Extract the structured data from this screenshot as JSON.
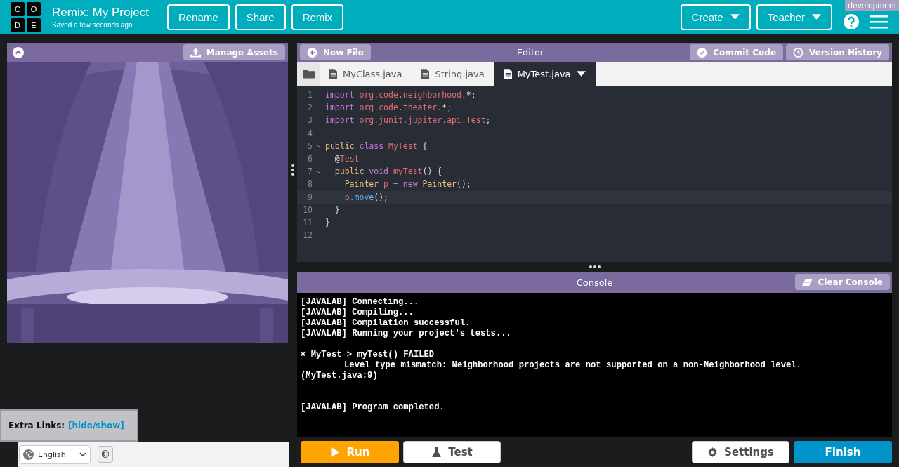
{
  "header": {
    "logo_letters": [
      "C",
      "O",
      "D",
      "E"
    ],
    "title": "Remix: My Project",
    "save_status": "Saved a few seconds ago",
    "actions": [
      "Rename",
      "Share",
      "Remix"
    ],
    "menus": [
      "Create",
      "Teacher"
    ],
    "environment_badge": "development"
  },
  "stage_panel": {
    "manage_assets": "Manage Assets"
  },
  "editor": {
    "title": "Editor",
    "new_file": "New File",
    "commit": "Commit Code",
    "history": "Version History",
    "tabs": [
      {
        "label": "MyClass.java",
        "selected": false
      },
      {
        "label": "String.java",
        "selected": false
      },
      {
        "label": "MyTest.java",
        "selected": true
      }
    ],
    "lines": [
      {
        "number": "1",
        "foldable": false,
        "selected": false,
        "tokens": [
          {
            "text": "import",
            "kind": "keyword"
          },
          {
            "text": " org",
            "kind": "name"
          },
          {
            "text": ".",
            "kind": "operator"
          },
          {
            "text": "code",
            "kind": "name"
          },
          {
            "text": ".",
            "kind": "operator"
          },
          {
            "text": "neighborhood",
            "kind": "name"
          },
          {
            "text": ".",
            "kind": "operator"
          },
          {
            "text": "*;",
            "kind": "plain"
          }
        ]
      },
      {
        "number": "2",
        "foldable": false,
        "selected": false,
        "tokens": [
          {
            "text": "import",
            "kind": "keyword"
          },
          {
            "text": " org",
            "kind": "name"
          },
          {
            "text": ".",
            "kind": "operator"
          },
          {
            "text": "code",
            "kind": "name"
          },
          {
            "text": ".",
            "kind": "operator"
          },
          {
            "text": "theater",
            "kind": "name"
          },
          {
            "text": ".",
            "kind": "operator"
          },
          {
            "text": "*;",
            "kind": "plain"
          }
        ]
      },
      {
        "number": "3",
        "foldable": false,
        "selected": false,
        "tokens": [
          {
            "text": "import",
            "kind": "keyword"
          },
          {
            "text": " org",
            "kind": "name"
          },
          {
            "text": ".",
            "kind": "operator"
          },
          {
            "text": "junit",
            "kind": "name"
          },
          {
            "text": ".",
            "kind": "operator"
          },
          {
            "text": "jupiter",
            "kind": "name"
          },
          {
            "text": ".",
            "kind": "operator"
          },
          {
            "text": "api",
            "kind": "name"
          },
          {
            "text": ".",
            "kind": "operator"
          },
          {
            "text": "Test",
            "kind": "name"
          },
          {
            "text": ";",
            "kind": "plain"
          }
        ]
      },
      {
        "number": "4",
        "foldable": false,
        "selected": false
      },
      {
        "number": "5",
        "foldable": true,
        "selected": false,
        "tokens": [
          {
            "text": "public",
            "kind": "type"
          },
          {
            "text": " class",
            "kind": "keyword"
          },
          {
            "text": " MyTest",
            "kind": "name"
          },
          {
            "text": " {",
            "kind": "plain"
          }
        ]
      },
      {
        "number": "6",
        "foldable": false,
        "selected": false,
        "tokens": [
          {
            "text": "  @",
            "kind": "plain"
          },
          {
            "text": "Test",
            "kind": "name"
          }
        ]
      },
      {
        "number": "7",
        "foldable": true,
        "selected": false,
        "tokens": [
          {
            "text": "  public",
            "kind": "type"
          },
          {
            "text": " void",
            "kind": "keyword"
          },
          {
            "text": " myTest",
            "kind": "name"
          },
          {
            "text": "() {",
            "kind": "plain"
          }
        ]
      },
      {
        "number": "8",
        "foldable": false,
        "selected": false,
        "tokens": [
          {
            "text": "    Painter",
            "kind": "type"
          },
          {
            "text": " p",
            "kind": "name"
          },
          {
            "text": " =",
            "kind": "operator"
          },
          {
            "text": " new",
            "kind": "keyword"
          },
          {
            "text": " Painter",
            "kind": "type"
          },
          {
            "text": "();",
            "kind": "plain"
          }
        ]
      },
      {
        "number": "9",
        "foldable": false,
        "selected": true,
        "tokens": [
          {
            "text": "    p",
            "kind": "name"
          },
          {
            "text": ".",
            "kind": "operator"
          },
          {
            "text": "move",
            "kind": "function"
          },
          {
            "text": "();",
            "kind": "plain"
          }
        ]
      },
      {
        "number": "10",
        "foldable": false,
        "selected": false,
        "tokens": [
          {
            "text": "  }",
            "kind": "plain"
          }
        ]
      },
      {
        "number": "11",
        "foldable": false,
        "selected": false,
        "tokens": [
          {
            "text": "}",
            "kind": "plain"
          }
        ]
      },
      {
        "number": "12",
        "foldable": false,
        "selected": false
      }
    ]
  },
  "console": {
    "title": "Console",
    "clear": "Clear Console",
    "blocks": [
      {
        "kind": "log",
        "lines": [
          {
            "kind": "plain",
            "text": "[JAVALAB] Connecting..."
          },
          {
            "kind": "plain",
            "text": "[JAVALAB] Compiling..."
          },
          {
            "kind": "plain",
            "text": "[JAVALAB] Compilation successful."
          },
          {
            "kind": "plain",
            "text": "[JAVALAB] Running your project's tests..."
          }
        ]
      },
      {
        "kind": "failure",
        "lines": [
          {
            "kind": "plain",
            "text": "✖ MyTest > myTest() FAILED"
          },
          {
            "kind": "detail",
            "text": "Level type mismatch: Neighborhood projects are not supported on a non-Neighborhood level."
          },
          {
            "kind": "plain",
            "text": "(MyTest.java:9)"
          }
        ]
      },
      {
        "kind": "summary",
        "lines": [
          {
            "kind": "plain",
            "text": "[JAVALAB] Program completed."
          }
        ]
      }
    ]
  },
  "controls": {
    "run": "Run",
    "test": "Test",
    "settings": "Settings",
    "finish": "Finish"
  },
  "footer": {
    "extra_links_label": "Extra Links:",
    "extra_links_toggle": "[hide/show]",
    "language": "English",
    "copyright": "©"
  }
}
